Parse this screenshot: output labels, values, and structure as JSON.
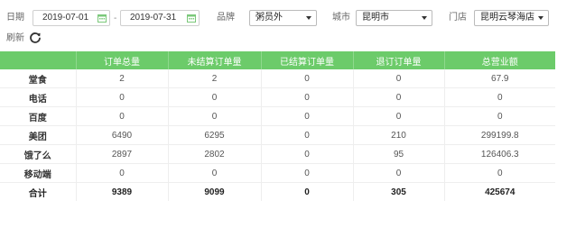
{
  "filters": {
    "date_label": "日期",
    "start_date": "2019-07-01",
    "end_date": "2019-07-31",
    "date_separator": "-",
    "brand_label": "品牌",
    "brand_value": "粥员外",
    "city_label": "城市",
    "city_value": "昆明市",
    "store_label": "门店",
    "store_value": "昆明云琴海店",
    "refresh_label": "刷新"
  },
  "table": {
    "headers": [
      "",
      "订单总量",
      "未结算订单量",
      "已结算订单量",
      "退订订单量",
      "总营业额"
    ],
    "rows": [
      [
        "堂食",
        "2",
        "2",
        "0",
        "0",
        "67.9"
      ],
      [
        "电话",
        "0",
        "0",
        "0",
        "0",
        "0"
      ],
      [
        "百度",
        "0",
        "0",
        "0",
        "0",
        "0"
      ],
      [
        "美团",
        "6490",
        "6295",
        "0",
        "210",
        "299199.8"
      ],
      [
        "饿了么",
        "2897",
        "2802",
        "0",
        "95",
        "126406.3"
      ],
      [
        "移动端",
        "0",
        "0",
        "0",
        "0",
        "0"
      ]
    ],
    "total": [
      "合计",
      "9389",
      "9099",
      "0",
      "305",
      "425674"
    ]
  },
  "colors": {
    "header_bg": "#6ccb6a",
    "calendar_icon": "#7bc87a"
  }
}
